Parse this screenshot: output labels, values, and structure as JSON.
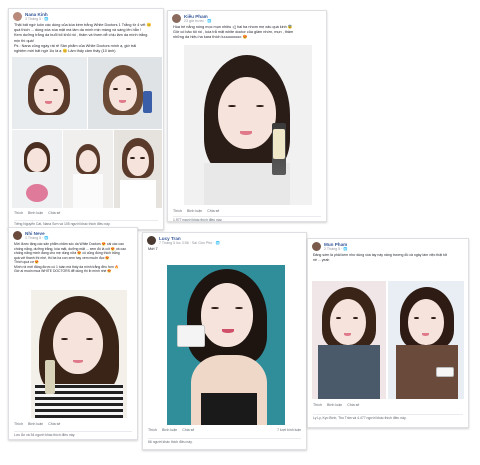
{
  "posts": [
    {
      "author": "Nana Kinh",
      "time": "3 Tháng 5 · 🌐",
      "text_lines": [
        "Thật bất ngờ luôn các dùng của kóa kém trắng White Doctors 1 Trắng từ 4 vết 😊",
        "quá thích ... dùng xóa xóa mặt mà làm da mình mịn màng và sáng lên hẳn !",
        "Kem dưỡng trắng da buổi tối khỏi rồi , thấm và thơm dễ chịu làm da mình trắng",
        "mịn thì quá!",
        "Ps : Nana cũng ngày rát rẻ Sản phẩm của White Doctors mình ạ, giờ trải",
        "nghiệm mới bất ngờ 1lọ là ạ 😊 Lâm thấy cảm thấy (10 ảnh)"
      ],
      "actions": [
        "Thích",
        "Bình luận",
        "Chia sẻ"
      ],
      "likes": "Tiếng Nguyễn Cát, Nana Sơn và 105 người khác thích điều này."
    },
    {
      "author": "Kiều Pham",
      "time": "23 giờ trước · 🌐",
      "text_lines": [
        "Hùa hè nắng nóng mọc mụn nhiều :(( hai ba nhom mẹ xấu quá kinh 😨",
        "Giờ có bảo tôi rồi , kóa trắ mặt white doctor của giảm nhờn, mụn , thâm",
        "những da hiệu ha kara thích luuuoooooo 😍"
      ],
      "actions": [
        "Thích",
        "Bình luận",
        "Chia sẻ"
      ],
      "likes": "1.977 người khác thích điều này."
    },
    {
      "author": "Nhi Neve",
      "time": "1 Tháng 5 · 🌐",
      "text_lines": [
        "Mới được tặng các sản phẩm chăm sóc da White Doctors 😍 cái các cao",
        "chống nắng, dưỡng trắng, kóa mặt, dưỡng mặt ... xem đó là cốt 😍 và cao",
        "chống nắng mình đang cho mẹ dùng nữa 😍 cô cũng đóng thích trắng",
        "quá với thanh thì nhé, thì ba ha con xem hay xem muốn đọc 😍",
        "Thích quá cơ 😍",
        "Mình rồi mới đăng được có 1 tuần mà thấy da mình trắng đều hơn 🔥",
        "Giờ ai muốn mua WHITE DOCTORS để dùng thì ib mình nhé 😍"
      ],
      "actions": [
        "Thích",
        "Bình luận",
        "Chia sẻ"
      ],
      "likes": "Lưu Ân và 54 người khác thích điều này."
    },
    {
      "author": "Lucy Tran",
      "time": "7 Tháng 5 lúc 3:56 · Sài Gòn Phú · 🌐",
      "text_lines": [
        "Mới 7"
      ],
      "actions": [
        "Thích",
        "Bình luận",
        "Chia sẻ"
      ],
      "comments": "7 lượt bình luận",
      "likes": "66 người khác thích điều này."
    },
    {
      "author": "Mun Pham",
      "time": "2 Tháng 5 · 🌐",
      "text_lines": [
        "Đảng sớm là phải kem như dùng xóa tay này nâng trương đồ cả ngày làm việc thật tốt",
        "nè ... yeah"
      ],
      "actions": [
        "Thích",
        "Bình luận",
        "Chia sẻ"
      ],
      "likes": "Ly Ly, Kyo Bình, Thu Trần và 4.477 người khác thích điều này."
    }
  ],
  "colors": {
    "link": "#365899",
    "muted": "#90949c",
    "border": "#dddfe2"
  }
}
